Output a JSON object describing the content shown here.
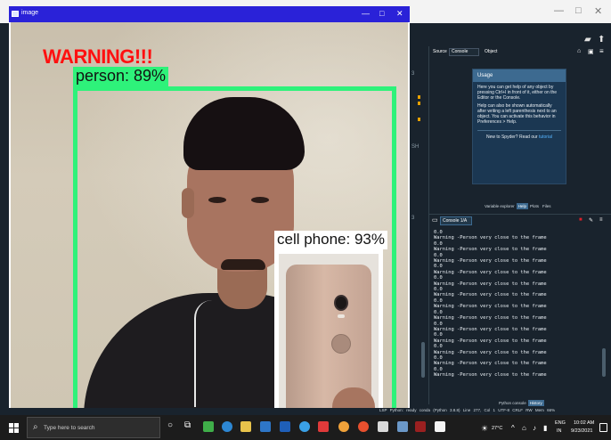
{
  "image_window": {
    "title": "image",
    "warning_text": "WARNING!!!",
    "detections": [
      {
        "label": "person: 89%",
        "color": "#2ef27a"
      },
      {
        "label": "cell phone: 93%",
        "color": "#ffffff"
      }
    ]
  },
  "spyder": {
    "help_toolbar": {
      "source_label": "Source",
      "source_value": "Console",
      "object_label": "Object"
    },
    "usage": {
      "title": "Usage",
      "para1": "Here you can get help of any object by pressing Ctrl+I in front of it, either on the Editor or the Console.",
      "para2": "Help can also be shown automatically after writing a left parenthesis next to an object. You can activate this behavior in Preferences > Help.",
      "new_prefix": "New to Spyder? Read our",
      "new_link": "tutorial"
    },
    "help_tabs": [
      "Variable explorer",
      "Help",
      "Plots",
      "Files"
    ],
    "console_tab": "Console 1/A",
    "console_lines": [
      "0.0",
      "Warning -Person very close to the frame",
      "0.0",
      "Warning -Person very close to the frame",
      "0.0",
      "Warning -Person very close to the frame",
      "0.0",
      "Warning -Person very close to the frame",
      "0.0",
      "Warning -Person very close to the frame",
      "0.0",
      "Warning -Person very close to the frame",
      "0.0",
      "Warning -Person very close to the frame",
      "0.0",
      "Warning -Person very close to the frame",
      "0.0",
      "Warning -Person very close to the frame",
      "0.0",
      "Warning -Person very close to the frame",
      "0.0",
      "Warning -Person very close to the frame",
      "0.0",
      "Warning -Person very close to the frame",
      "0.0",
      "Warning -Person very close to the frame"
    ],
    "console_bottom_tabs": [
      "Python console",
      "History"
    ],
    "statusbar": "LSP Python: ready   conda (Python 3.8.8)   Line 277, Col 1   UTF-8   CRLF   RW   Mem 66%",
    "gutter_text": [
      "3",
      "SH",
      "3"
    ]
  },
  "taskbar": {
    "search_placeholder": "Type here to search",
    "weather": "27°C",
    "lang_top": "ENG",
    "lang_bottom": "IN",
    "time": "10:02 AM",
    "date": "9/23/2021"
  }
}
